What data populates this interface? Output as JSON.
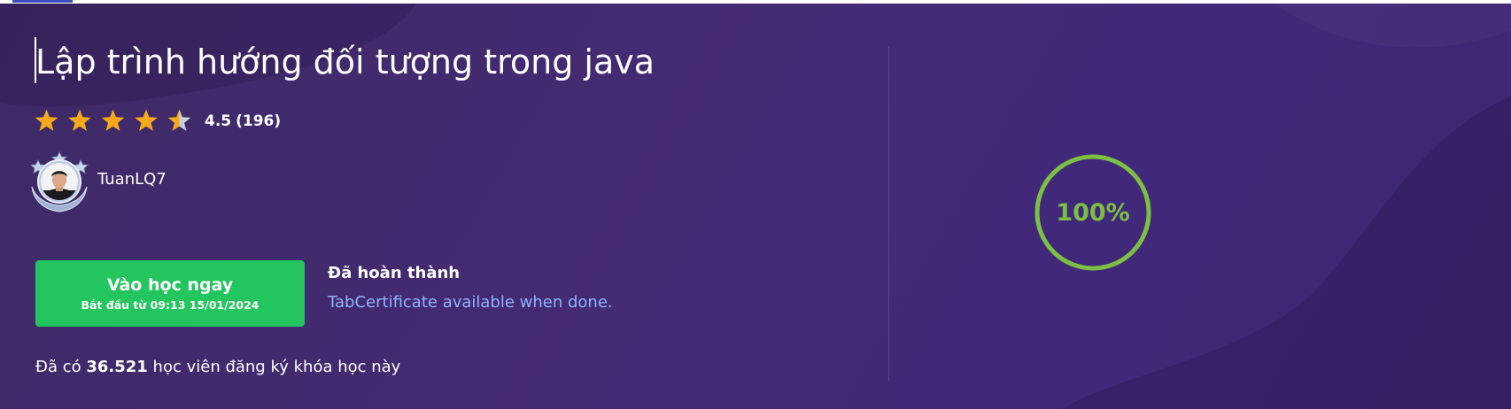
{
  "course": {
    "title": "Lập trình hướng đối tượng trong java",
    "rating_value": "4.5",
    "rating_count": "(196)",
    "rating_fraction": 0.9,
    "author_name": "TuanLQ7"
  },
  "cta": {
    "label": "Vào học ngay",
    "start_text": "Bắt đầu từ 09:13 15/01/2024"
  },
  "status": {
    "label": "Đã hoàn thành",
    "certificate_link": "TabCertificate available when done."
  },
  "enrollment": {
    "prefix": "Đã có",
    "count": "36.521",
    "suffix": "học viên đăng ký khóa học này"
  },
  "progress": {
    "value_text": "100%",
    "fraction": 1.0
  },
  "colors": {
    "star": "#f7a81b",
    "star_empty": "#c9cfdb",
    "cta_bg": "#22c55e",
    "link": "#8fb4ff",
    "progress_ring": "#7bc043"
  }
}
